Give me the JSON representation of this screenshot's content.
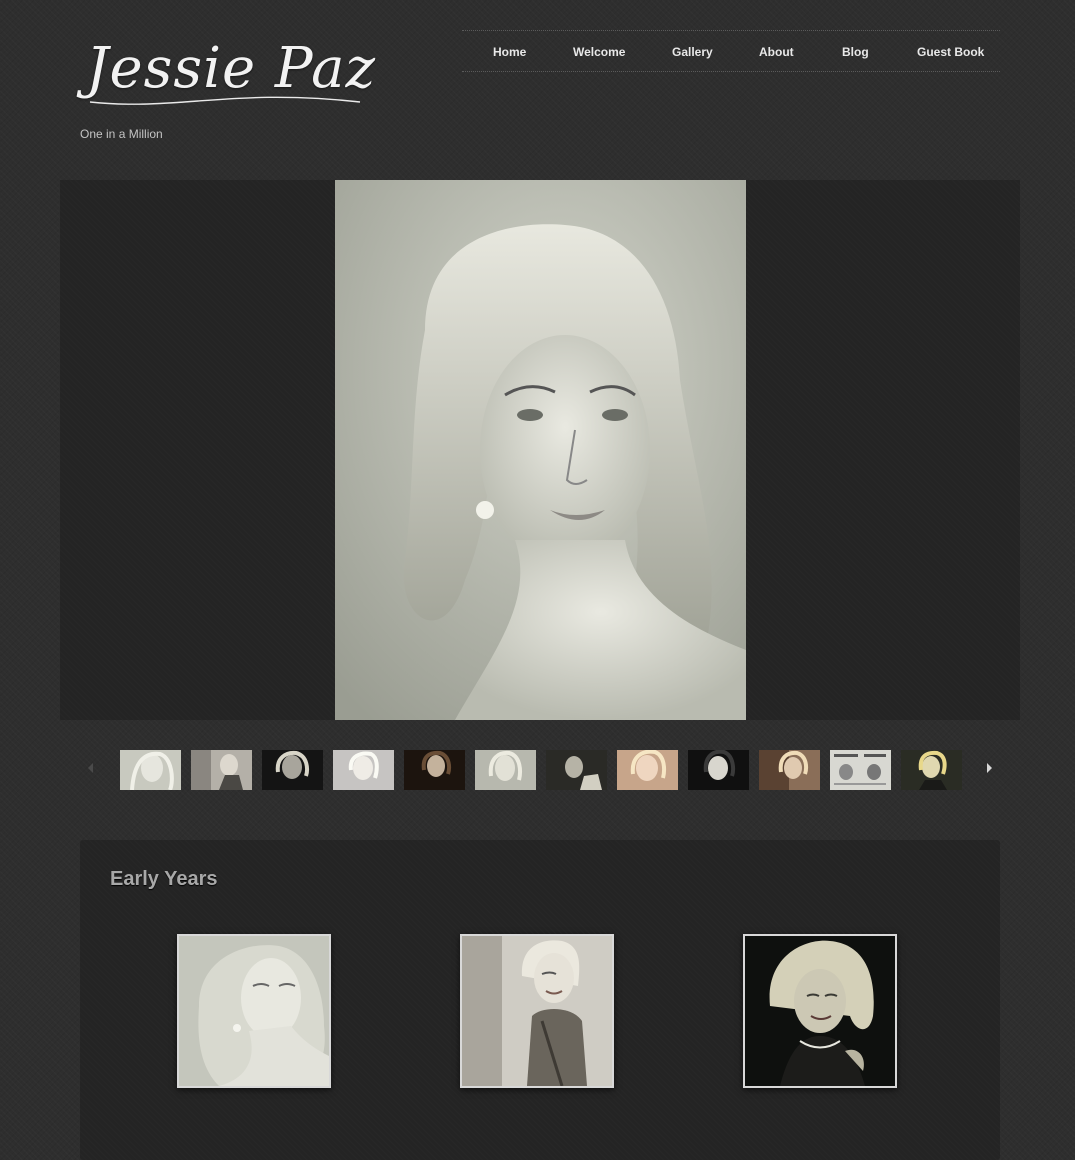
{
  "header": {
    "site_title": "Jessie Paz",
    "tagline": "One in a Million"
  },
  "nav": {
    "items": [
      "Home",
      "Welcome",
      "Gallery",
      "About",
      "Blog",
      "Guest Book"
    ]
  },
  "slideshow": {
    "main_image": "portrait-photo",
    "thumbnail_count": 12
  },
  "album": {
    "title": "Early Years",
    "photo_count": 3
  },
  "colors": {
    "background": "#2e2e2e",
    "panel": "#242424",
    "text": "#e8e8e8",
    "muted": "#a8a8a8"
  }
}
